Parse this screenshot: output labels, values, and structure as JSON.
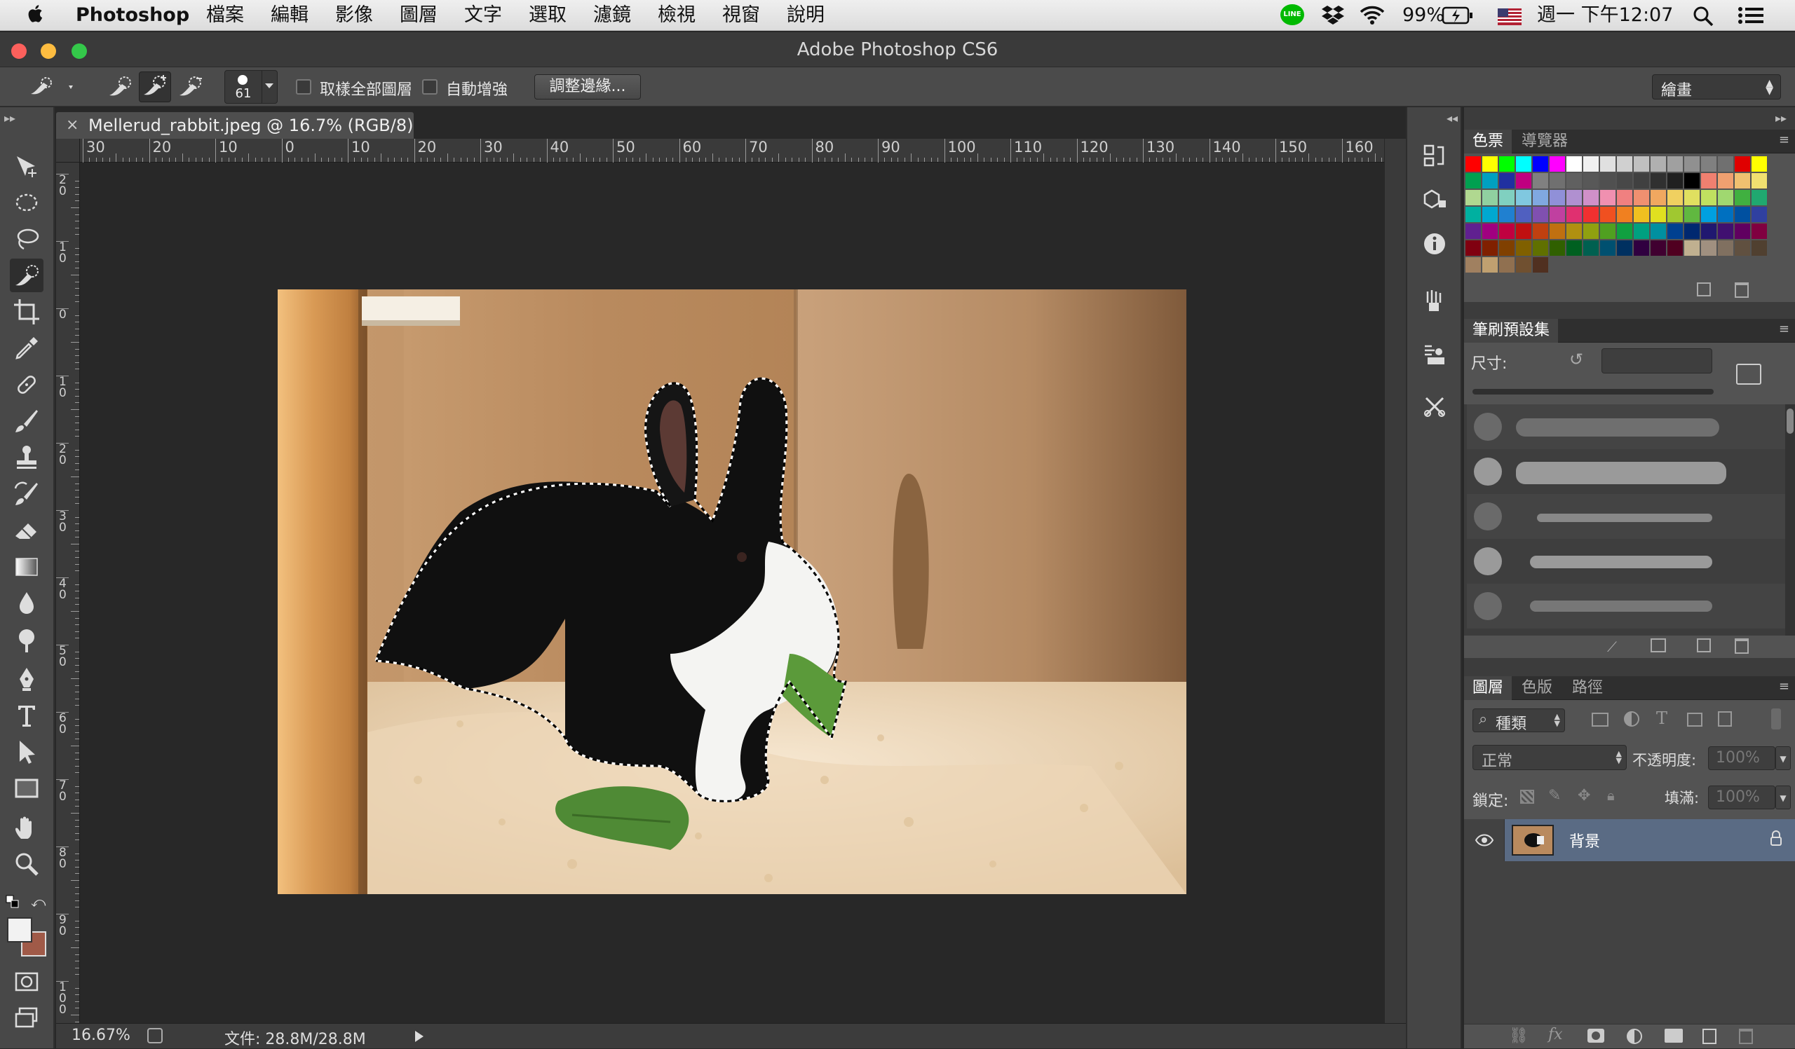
{
  "menubar": {
    "app_name": "Photoshop",
    "items": [
      "檔案",
      "編輯",
      "影像",
      "圖層",
      "文字",
      "選取",
      "濾鏡",
      "檢視",
      "視窗",
      "說明"
    ],
    "battery": "99%",
    "clock": "週一 下午12:07"
  },
  "window": {
    "title": "Adobe Photoshop CS6"
  },
  "options": {
    "brush_size": "61",
    "sample_all_layers": "取樣全部圖層",
    "auto_enhance": "自動增強",
    "refine_edge": "調整邊緣...",
    "workspace": "繪畫"
  },
  "document": {
    "tab_title": "Mellerud_rabbit.jpeg @ 16.7% (RGB/8)",
    "hruler_ticks": [
      "30",
      "20",
      "10",
      "0",
      "10",
      "20",
      "30",
      "40",
      "50",
      "60",
      "70",
      "80",
      "90",
      "100",
      "110",
      "120",
      "130",
      "140",
      "150",
      "160"
    ],
    "vruler_ticks": [
      "20",
      "10",
      "0",
      "10",
      "20",
      "30",
      "40",
      "50",
      "60",
      "70",
      "80",
      "90",
      "100"
    ]
  },
  "status": {
    "zoom": "16.67%",
    "doc_size": "文件: 28.8M/28.8M"
  },
  "swatches_panel": {
    "tabs": [
      "色票",
      "導覽器"
    ],
    "colors": [
      "#ff0000",
      "#ffff00",
      "#00ff00",
      "#00ffff",
      "#0000ff",
      "#ff00ff",
      "#ffffff",
      "#f0f0f0",
      "#e0e0e0",
      "#d0d0d0",
      "#c0c0c0",
      "#b0b0b0",
      "#a0a0a0",
      "#909090",
      "#808080",
      "#707070",
      "#e00000",
      "#ffff00",
      "#00a050",
      "#00a0c0",
      "#2030a0",
      "#c00080",
      "#808080",
      "#707070",
      "#606060",
      "#585858",
      "#505050",
      "#484848",
      "#404040",
      "#303030",
      "#202020",
      "#000000",
      "#f08070",
      "#f0a070",
      "#f0c070",
      "#f0e070",
      "#b0d890",
      "#90d0a0",
      "#80d0c0",
      "#80c8e0",
      "#80a8e0",
      "#9090d8",
      "#b090d0",
      "#d090c8",
      "#f090b0",
      "#f08080",
      "#f09070",
      "#f0a860",
      "#f0d060",
      "#e0e060",
      "#c0e060",
      "#a0d870",
      "#40b040",
      "#20a870",
      "#00b0a0",
      "#00a8d0",
      "#2080d0",
      "#5060c0",
      "#8050b0",
      "#c040a0",
      "#e03070",
      "#f03030",
      "#f05020",
      "#f08020",
      "#f0c020",
      "#e0e020",
      "#a0c830",
      "#60b840",
      "#00a0e0",
      "#0070c0",
      "#0050a0",
      "#3040a0",
      "#602090",
      "#a00080",
      "#c00040",
      "#c01010",
      "#c04010",
      "#c07010",
      "#b09010",
      "#90a010",
      "#50a020",
      "#10a040",
      "#00a080",
      "#0090a0",
      "#004090",
      "#002870",
      "#201870",
      "#401070",
      "#600060",
      "#800040",
      "#800010",
      "#802000",
      "#804000",
      "#806000",
      "#607000",
      "#306000",
      "#006020",
      "#006050",
      "#005070",
      "#003060",
      "#300040",
      "#400030",
      "#500020",
      "#c0b090",
      "#a09080",
      "#807060",
      "#605040",
      "#504030",
      "#a08060",
      "#c0a070",
      "#907050",
      "#705030",
      "#503020"
    ]
  },
  "brush_panel": {
    "tab": "筆刷預設集",
    "size_label": "尺寸:"
  },
  "layers_panel": {
    "tabs": [
      "圖層",
      "色版",
      "路徑"
    ],
    "filter": "種類",
    "blend_mode": "正常",
    "opacity_label": "不透明度:",
    "opacity": "100%",
    "lock_label": "鎖定:",
    "fill_label": "填滿:",
    "fill": "100%",
    "layers": [
      {
        "name": "背景"
      }
    ]
  }
}
